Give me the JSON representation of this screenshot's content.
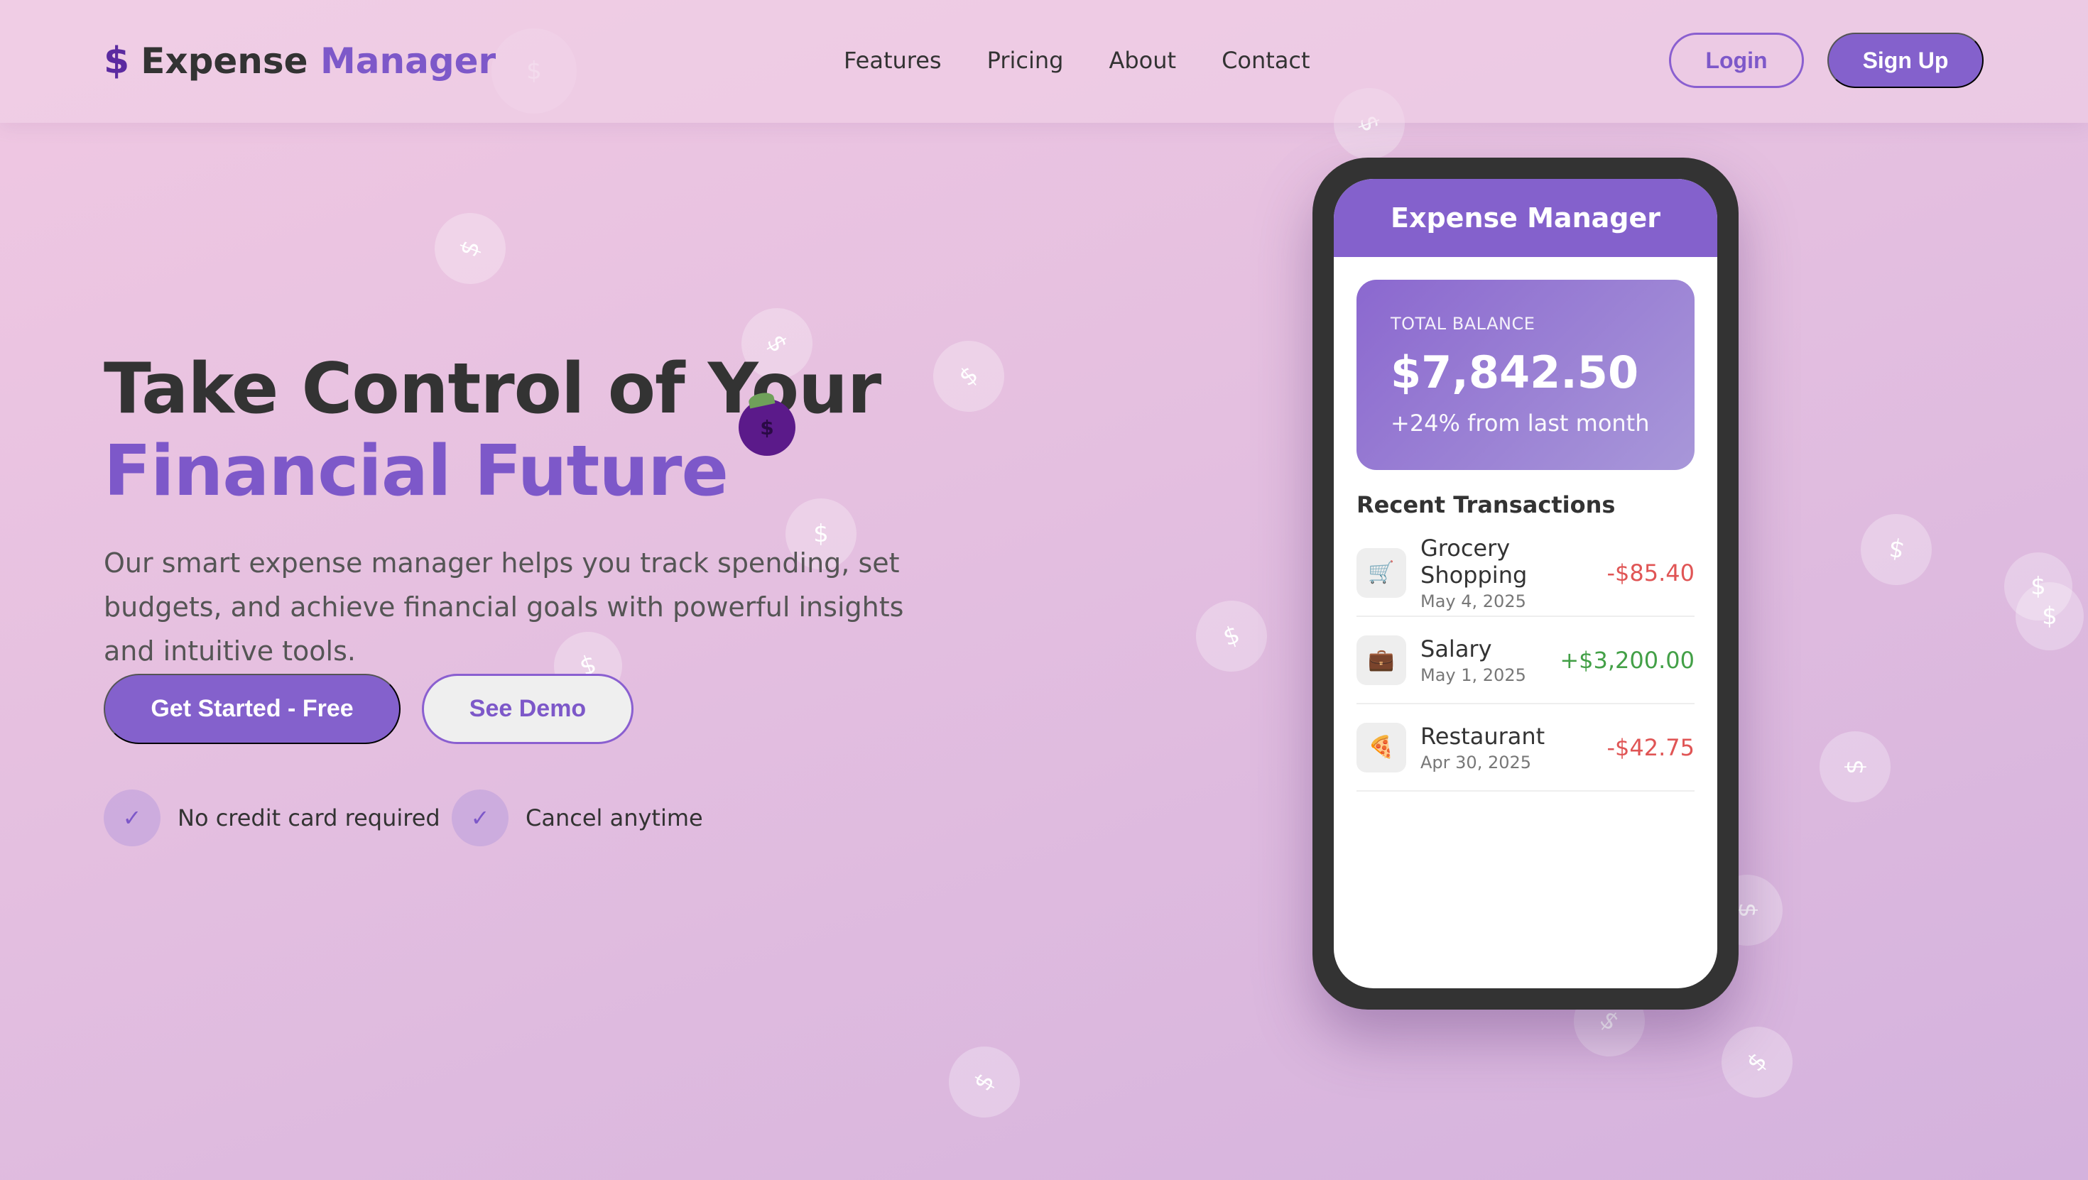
{
  "brand": {
    "icon": "$",
    "name_part1": "Expense",
    "name_part2": "Manager"
  },
  "nav": {
    "links": [
      "Features",
      "Pricing",
      "About",
      "Contact"
    ],
    "login_label": "Login",
    "signup_label": "Sign Up"
  },
  "hero": {
    "title_line1": "Take Control of Your",
    "title_line2": "Financial Future",
    "description": "Our smart expense manager helps you track spending, set budgets, and achieve financial goals with powerful insights and intuitive tools.",
    "primary_cta": "Get Started - Free",
    "secondary_cta": "See Demo",
    "perks": [
      {
        "icon": "check-icon",
        "label": "No credit card required",
        "glyph": "✓"
      },
      {
        "icon": "check-icon",
        "label": "Cancel anytime",
        "glyph": "✓"
      }
    ]
  },
  "phone": {
    "app_title": "Expense Manager",
    "balance_label": "TOTAL BALANCE",
    "balance_amount": "$7,842.50",
    "balance_change": "+24% from last month",
    "recent_title": "Recent Transactions",
    "transactions": [
      {
        "icon": "🛒",
        "icon_name": "shopping-cart-icon",
        "name": "Grocery Shopping",
        "date": "May 4, 2025",
        "amount": "-$85.40",
        "color": "#e05555"
      },
      {
        "icon": "💼",
        "icon_name": "briefcase-icon",
        "name": "Salary",
        "date": "May 1, 2025",
        "amount": "+$3,200.00",
        "color": "#43a047"
      },
      {
        "icon": "🍕",
        "icon_name": "pizza-icon",
        "name": "Restaurant",
        "date": "Apr 30, 2025",
        "amount": "-$42.75",
        "color": "#e05555"
      }
    ]
  },
  "decor": {
    "coin_glyph": "$",
    "bubble_glyphs": [
      "$",
      "$",
      "$",
      "$",
      "$",
      "$",
      "$",
      "$",
      "$",
      "$",
      "$",
      "$",
      "$",
      "$",
      "$",
      "$"
    ]
  },
  "colors": {
    "accent": "#8461cc",
    "accent_text": "#7d58c9",
    "negative": "#e05555",
    "positive": "#43a047"
  }
}
